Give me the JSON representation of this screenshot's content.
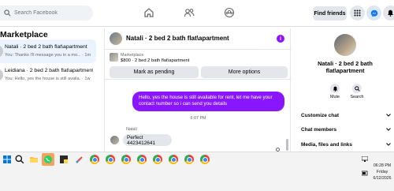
{
  "topbar": {
    "search_placeholder": "Search Facebook",
    "nav_icons": [
      "home-icon",
      "friends-icon",
      "groups-icon"
    ],
    "find_friends_label": "Find friends",
    "right_icons": [
      "grid-menu-icon",
      "messenger-icon",
      "notifications-icon"
    ]
  },
  "sidebar": {
    "title": "Marketplace",
    "conversations": [
      {
        "name": "Natali · 2 bed 2 bath flat\\apartment",
        "preview": "You: Thanks I'll message you in a mo...",
        "time": "· 1m",
        "active": true
      },
      {
        "name": "Leidiana · 2 bed 2 bath flat\\apartment",
        "preview": "You: Hello, yes the house is still availa...",
        "time": "· 1w",
        "active": false
      }
    ]
  },
  "chat": {
    "title": "Natali · 2 bed 2 bath flat\\apartment",
    "listing": {
      "label": "Marketplace",
      "price_line": "$800 · 2 bed 2 bath flat\\apartment",
      "pending_label": "Mark as pending",
      "more_options_label": "More options"
    },
    "messages": [
      {
        "direction": "outgoing",
        "text": "Hello, yes the house is still available for rent, let me have your contact number so i can send you details"
      },
      {
        "direction": "incoming",
        "sender": "Natali",
        "text": "Perfect 4423412641"
      }
    ],
    "timestamp": "6:07 PM"
  },
  "info_panel": {
    "name": "Natali · 2 bed 2 bath flat\\apartment",
    "actions": [
      {
        "icon": "bell-icon",
        "label": "Mute"
      },
      {
        "icon": "search-icon",
        "label": "Search"
      }
    ],
    "sections": [
      "Customize chat",
      "Chat members",
      "Media, files and links"
    ]
  },
  "taskbar": {
    "apps": [
      "windows-start-icon",
      "search-icon",
      "file-explorer-icon",
      "whatsapp-icon",
      "sticky-notes-icon",
      "paint-icon",
      "chrome-icon"
    ],
    "tray": {
      "time": "06:28 PM",
      "day": "Friday",
      "date": "6/12/2026"
    }
  },
  "colors": {
    "accent": "#8a16ff",
    "facebook_blue": "#1877f2",
    "active_conv_bg": "#ebf3ff"
  }
}
